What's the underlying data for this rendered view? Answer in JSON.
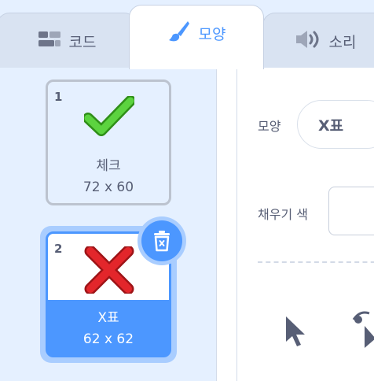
{
  "tabs": {
    "code_label": "코드",
    "costume_label": "모양",
    "sound_label": "소리"
  },
  "costumes": [
    {
      "number": "1",
      "name": "체크",
      "size": "72 x 60",
      "icon": "check-icon",
      "selected": false
    },
    {
      "number": "2",
      "name": "X표",
      "size": "62 x 62",
      "icon": "x-mark-icon",
      "selected": true
    }
  ],
  "editor": {
    "costume_label": "모양",
    "costume_name": "X표",
    "fill_label": "채우기 색"
  },
  "icons": {
    "code_tab": "code-blocks-icon",
    "costume_tab": "paintbrush-icon",
    "sound_tab": "speaker-icon",
    "delete": "trash-icon",
    "select_tool": "arrow-cursor-icon",
    "reshape_tool": "reshape-cursor-icon"
  },
  "colors": {
    "accent": "#4c97ff",
    "text": "#575e75",
    "check": "#4cd137",
    "cross": "#e3262b"
  }
}
